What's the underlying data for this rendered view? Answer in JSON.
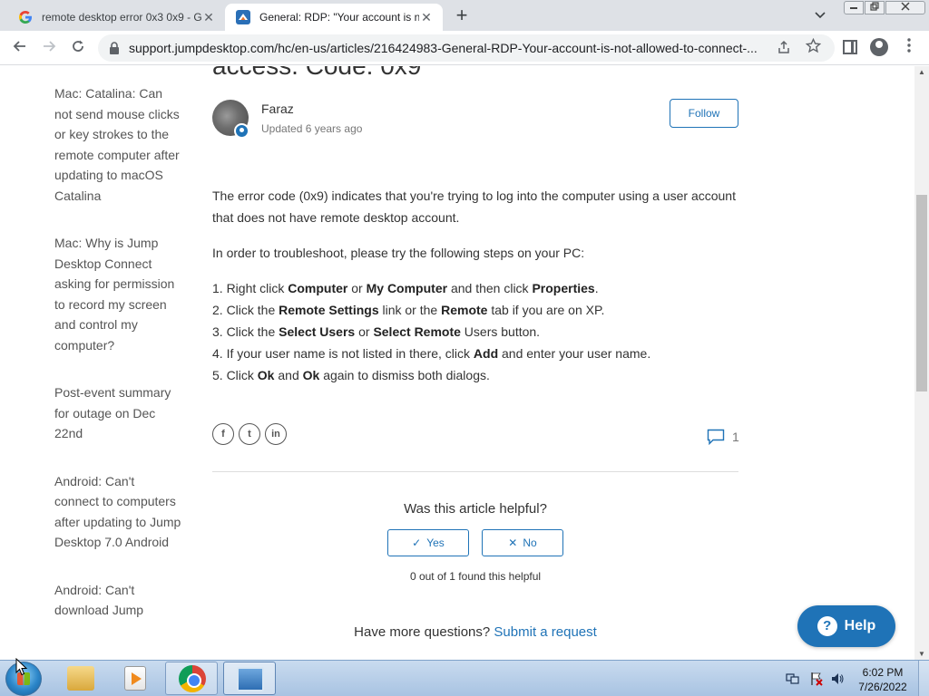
{
  "browser": {
    "tabs": [
      {
        "title": "remote desktop error 0x3 0x9 - G",
        "favicon": "google-g-icon",
        "close": "✕"
      },
      {
        "title": "General: RDP: \"Your account is n",
        "favicon": "jumpdesktop-icon",
        "close": "✕"
      }
    ],
    "new_tab": "+",
    "url": "support.jumpdesktop.com/hc/en-us/articles/216424983-General-RDP-Your-account-is-not-allowed-to-connect-..."
  },
  "article": {
    "title_fragment": "access. Code: 0x9",
    "author": {
      "name": "Faraz",
      "updated": "Updated 6 years ago"
    },
    "follow_label": "Follow",
    "intro": "The error code (0x9) indicates that you're trying to log into the computer using a user account that does not have remote desktop account.",
    "troubleshoot": "In order to troubleshoot, please try the following steps on your PC:",
    "steps": [
      {
        "t1": "1. Right click ",
        "b1": "Computer",
        "t2": " or ",
        "b2": "My Computer",
        "t3": " and then click ",
        "b3": "Properties",
        "t4": "."
      },
      {
        "t1": "2. Click the ",
        "b1": "Remote Settings",
        "t2": " link or the ",
        "b2": "Remote",
        "t3": " tab if you are on XP.",
        "b3": "",
        "t4": ""
      },
      {
        "t1": "3. Click the ",
        "b1": "Select Users",
        "t2": " or ",
        "b2": "Select Remote",
        "t3": " Users button.",
        "b3": "",
        "t4": ""
      },
      {
        "t1": "4. If your user name is not listed in there, click ",
        "b1": "Add",
        "t2": " and enter your user name.",
        "b2": "",
        "t3": "",
        "b3": "",
        "t4": ""
      },
      {
        "t1": "5. Click ",
        "b1": "Ok",
        "t2": " and ",
        "b2": "Ok",
        "t3": " again to dismiss both dialogs.",
        "b3": "",
        "t4": ""
      }
    ],
    "share": {
      "facebook": "f",
      "twitter": "t",
      "linkedin": "in"
    },
    "comments_count": "1",
    "vote": {
      "question": "Was this article helpful?",
      "yes_mark": "✓",
      "yes": "Yes",
      "no_mark": "✕",
      "no": "No",
      "count": "0 out of 1 found this helpful"
    },
    "more_questions": "Have more questions?",
    "submit_request": "Submit a request"
  },
  "sidebar": {
    "items": [
      "Mac: Catalina: Can not send mouse clicks or key strokes to the remote computer after updating to macOS Catalina",
      "Mac: Why is Jump Desktop Connect asking for permission to record my screen and control my computer?",
      "Post-event summary for outage on Dec 22nd",
      "Android: Can't connect to computers after updating to Jump Desktop 7.0 Android",
      "Android: Can't download Jump"
    ]
  },
  "help_widget": {
    "label": "Help",
    "icon_glyph": "?"
  },
  "taskbar": {
    "clock_time": "6:02 PM",
    "clock_date": "7/26/2022"
  },
  "colors": {
    "accent": "#1f73b7",
    "tabstrip": "#dee1e6",
    "text": "#333333",
    "taskbar": "#a8c3e2"
  }
}
